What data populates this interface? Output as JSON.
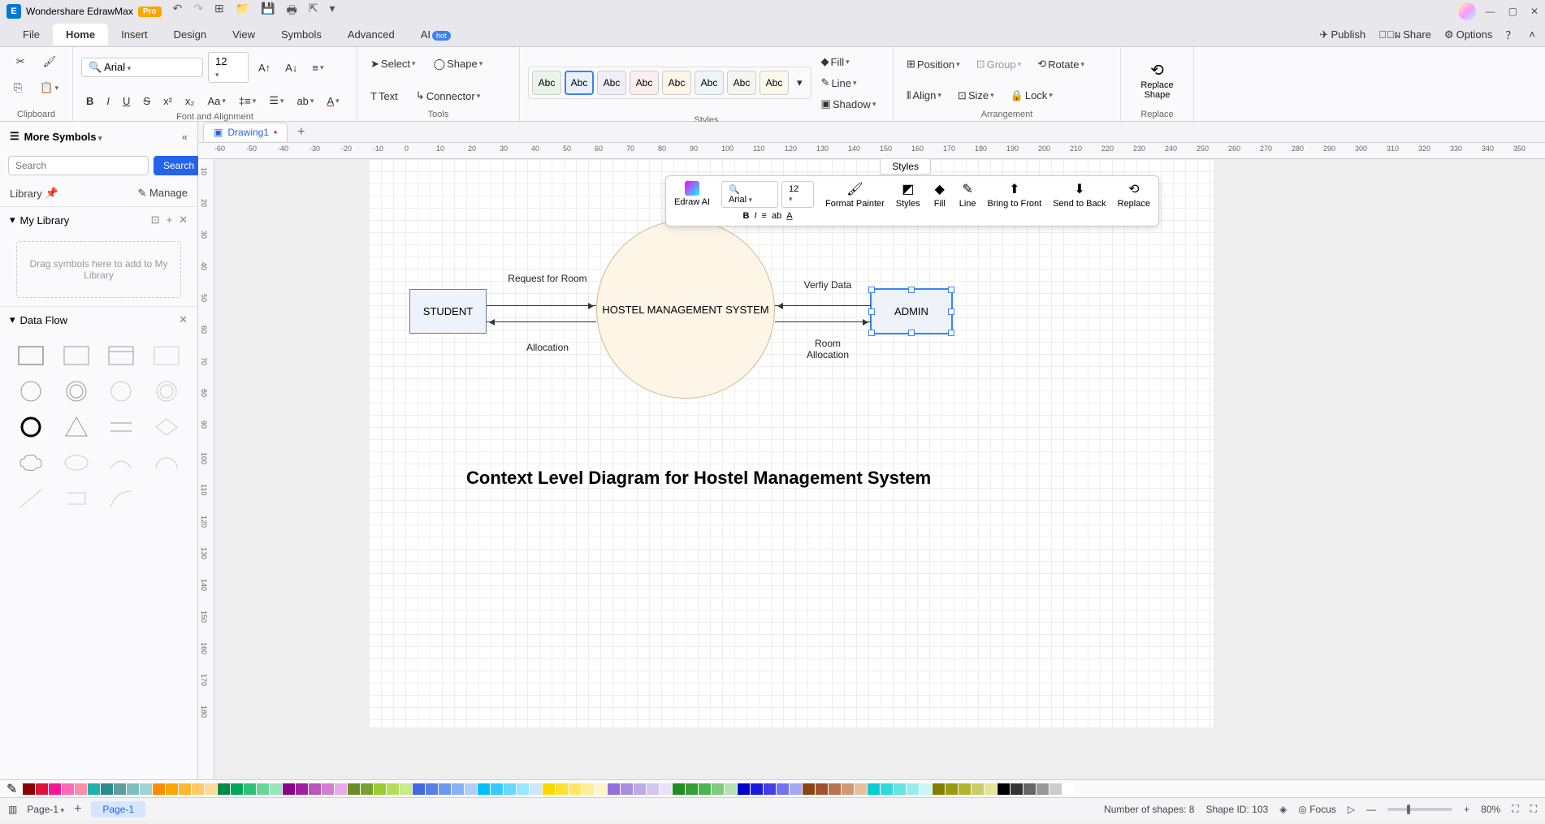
{
  "app": {
    "title": "Wondershare EdrawMax",
    "pro_badge": "Pro"
  },
  "menubar": {
    "tabs": [
      "File",
      "Home",
      "Insert",
      "Design",
      "View",
      "Symbols",
      "Advanced",
      "AI"
    ],
    "active_index": 1,
    "hot_badge": "hot",
    "right": {
      "publish": "Publish",
      "share": "Share",
      "options": "Options"
    }
  },
  "ribbon": {
    "clipboard_label": "Clipboard",
    "font_label": "Font and Alignment",
    "tools_label": "Tools",
    "styles_label": "Styles",
    "arrangement_label": "Arrangement",
    "replace_label": "Replace",
    "font_name": "Arial",
    "font_size": "12",
    "select_btn": "Select",
    "text_btn": "Text",
    "shape_btn": "Shape",
    "connector_btn": "Connector",
    "fill_btn": "Fill",
    "line_btn": "Line",
    "shadow_btn": "Shadow",
    "position_btn": "Position",
    "align_btn": "Align",
    "group_btn": "Group",
    "size_btn": "Size",
    "rotate_btn": "Rotate",
    "lock_btn": "Lock",
    "replace_shape_btn": "Replace Shape",
    "style_swatch_text": "Abc"
  },
  "sidebar": {
    "more_symbols": "More Symbols",
    "search_placeholder": "Search",
    "search_btn": "Search",
    "library_label": "Library",
    "manage_label": "Manage",
    "my_library": "My Library",
    "drop_hint": "Drag symbols here to add to My Library",
    "data_flow": "Data Flow"
  },
  "doc": {
    "tab_name": "Drawing1",
    "add_tab": "+"
  },
  "ruler_h_ticks": [
    "-60",
    "-50",
    "-40",
    "-30",
    "-20",
    "-10",
    "0",
    "10",
    "20",
    "30",
    "40",
    "50",
    "60",
    "70",
    "80",
    "90",
    "100",
    "110",
    "120",
    "130",
    "140",
    "150",
    "160",
    "170",
    "180",
    "190",
    "200",
    "210",
    "220",
    "230",
    "240",
    "250",
    "260",
    "270",
    "280",
    "290",
    "300",
    "310",
    "320",
    "330",
    "340",
    "350"
  ],
  "ruler_v_ticks": [
    "10",
    "20",
    "30",
    "40",
    "50",
    "60",
    "70",
    "80",
    "90",
    "100",
    "110",
    "120",
    "130",
    "140",
    "150",
    "160",
    "170",
    "180"
  ],
  "diagram": {
    "student": "STUDENT",
    "admin": "ADMIN",
    "center": "HOSTEL MANAGEMENT SYSTEM",
    "req_room": "Request for Room",
    "allocation": "Allocation",
    "verify": "Verfiy Data",
    "room_alloc": "Room Allocation",
    "title": "Context Level Diagram for Hostel Management System"
  },
  "float_toolbar": {
    "styles_pop": "Styles",
    "edraw_ai": "Edraw AI",
    "font_name": "Arial",
    "font_size": "12",
    "format_painter": "Format Painter",
    "styles": "Styles",
    "fill": "Fill",
    "line": "Line",
    "bring_front": "Bring to Front",
    "send_back": "Send to Back",
    "replace": "Replace"
  },
  "statusbar": {
    "page_dropdown": "Page-1",
    "page_tab": "Page-1",
    "shapes_count": "Number of shapes: 8",
    "shape_id": "Shape ID: 103",
    "focus": "Focus",
    "zoom": "80%"
  },
  "colors": [
    "#8b0000",
    "#dc143c",
    "#ff1493",
    "#ff69b4",
    "#ff8ca8",
    "#20b2aa",
    "#2e8b8b",
    "#5f9e9e",
    "#7fbfbf",
    "#9fd4d4",
    "#ff8c00",
    "#ffa500",
    "#ffb732",
    "#ffc966",
    "#ffdb99",
    "#008b45",
    "#00a855",
    "#2ec276",
    "#66d699",
    "#99e6bb",
    "#8b008b",
    "#a020a0",
    "#ba55ba",
    "#d080d0",
    "#e8aae8",
    "#6b8e23",
    "#7ba032",
    "#9acd32",
    "#b3de5a",
    "#cce98e",
    "#4169e1",
    "#5580e8",
    "#6a98ef",
    "#8bb0f4",
    "#b0ccf9",
    "#00bfff",
    "#33ccff",
    "#66d9ff",
    "#99e6ff",
    "#cce6ff",
    "#ffd700",
    "#ffe033",
    "#ffe766",
    "#ffee99",
    "#fff5cc",
    "#9370db",
    "#a88de2",
    "#bea9e9",
    "#d3c5f0",
    "#e9e2f7",
    "#228b22",
    "#32a032",
    "#4cb64c",
    "#7fcc7f",
    "#b2e2b2",
    "#0000cd",
    "#1a1add",
    "#4040e8",
    "#7373f0",
    "#a6a6f7",
    "#8b4513",
    "#a0522d",
    "#b8734a",
    "#d09973",
    "#e6bfa0",
    "#00ced1",
    "#33d8da",
    "#66e2e3",
    "#99ecec",
    "#ccf5f5",
    "#808000",
    "#999914",
    "#b3b333",
    "#cccc66",
    "#e5e599",
    "#000000",
    "#333333",
    "#666666",
    "#999999",
    "#cccccc",
    "#ffffff"
  ]
}
